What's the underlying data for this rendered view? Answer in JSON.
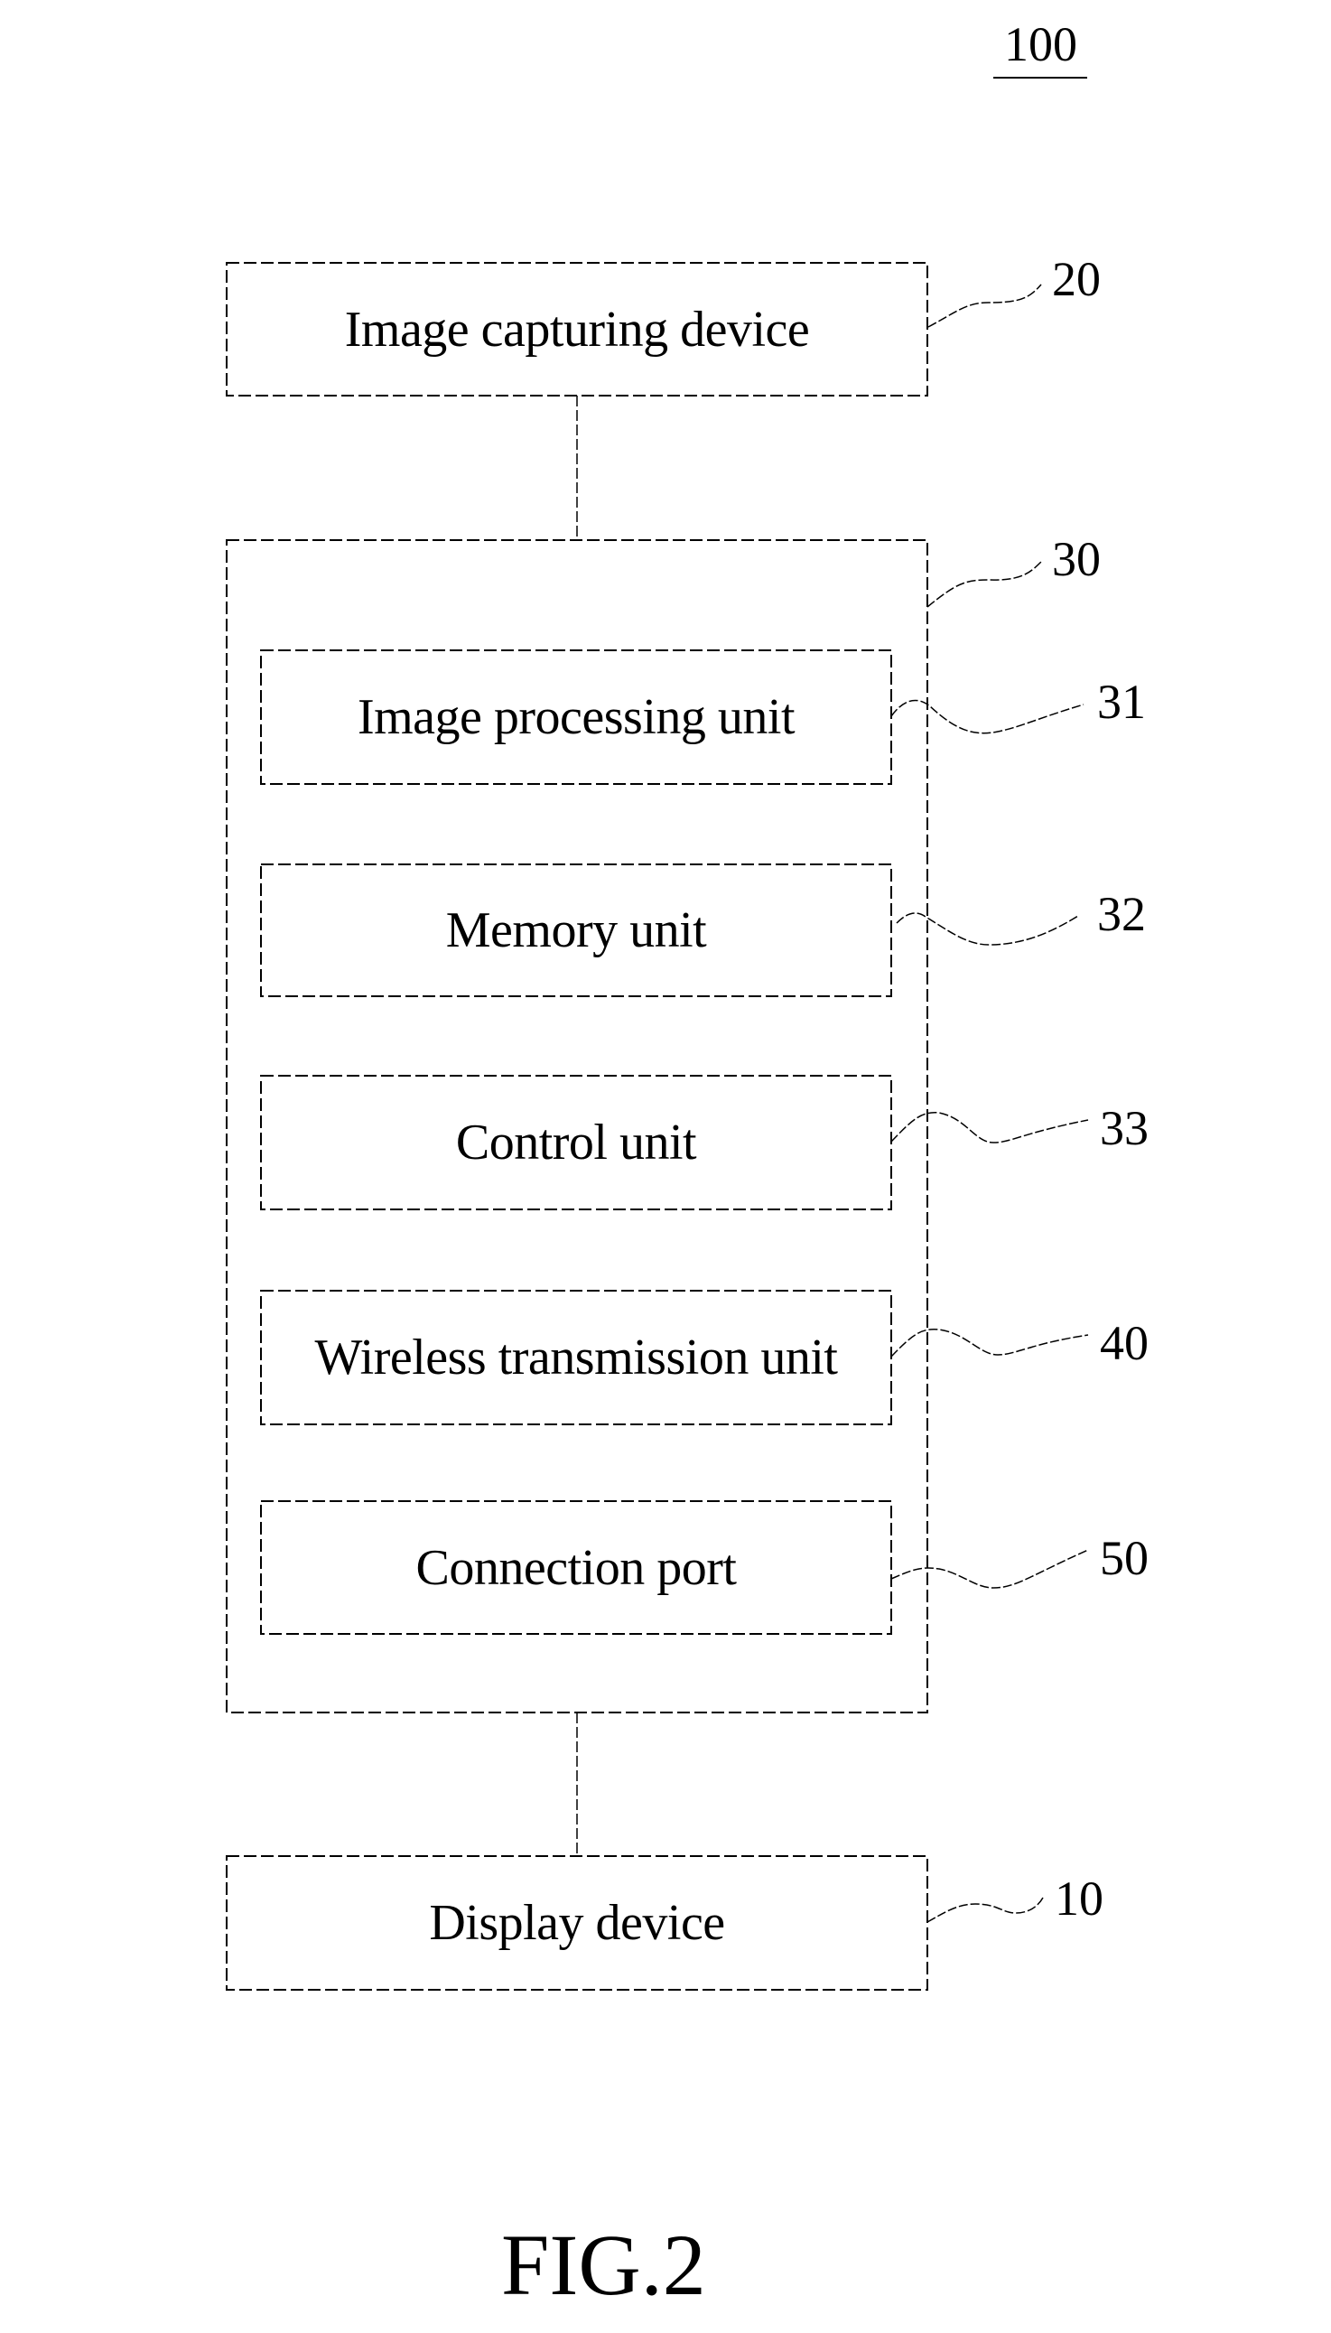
{
  "figure_ref": "100",
  "figure_caption": "FIG.2",
  "blocks": {
    "image_capturing": {
      "label": "Image capturing device",
      "ref": "20"
    },
    "processing_module": {
      "ref": "30"
    },
    "image_processing": {
      "label": "Image processing unit",
      "ref": "31"
    },
    "memory": {
      "label": "Memory unit",
      "ref": "32"
    },
    "control": {
      "label": "Control unit",
      "ref": "33"
    },
    "wireless": {
      "label": "Wireless transmission unit",
      "ref": "40"
    },
    "connection_port": {
      "label": "Connection port",
      "ref": "50"
    },
    "display": {
      "label": "Display device",
      "ref": "10"
    }
  }
}
